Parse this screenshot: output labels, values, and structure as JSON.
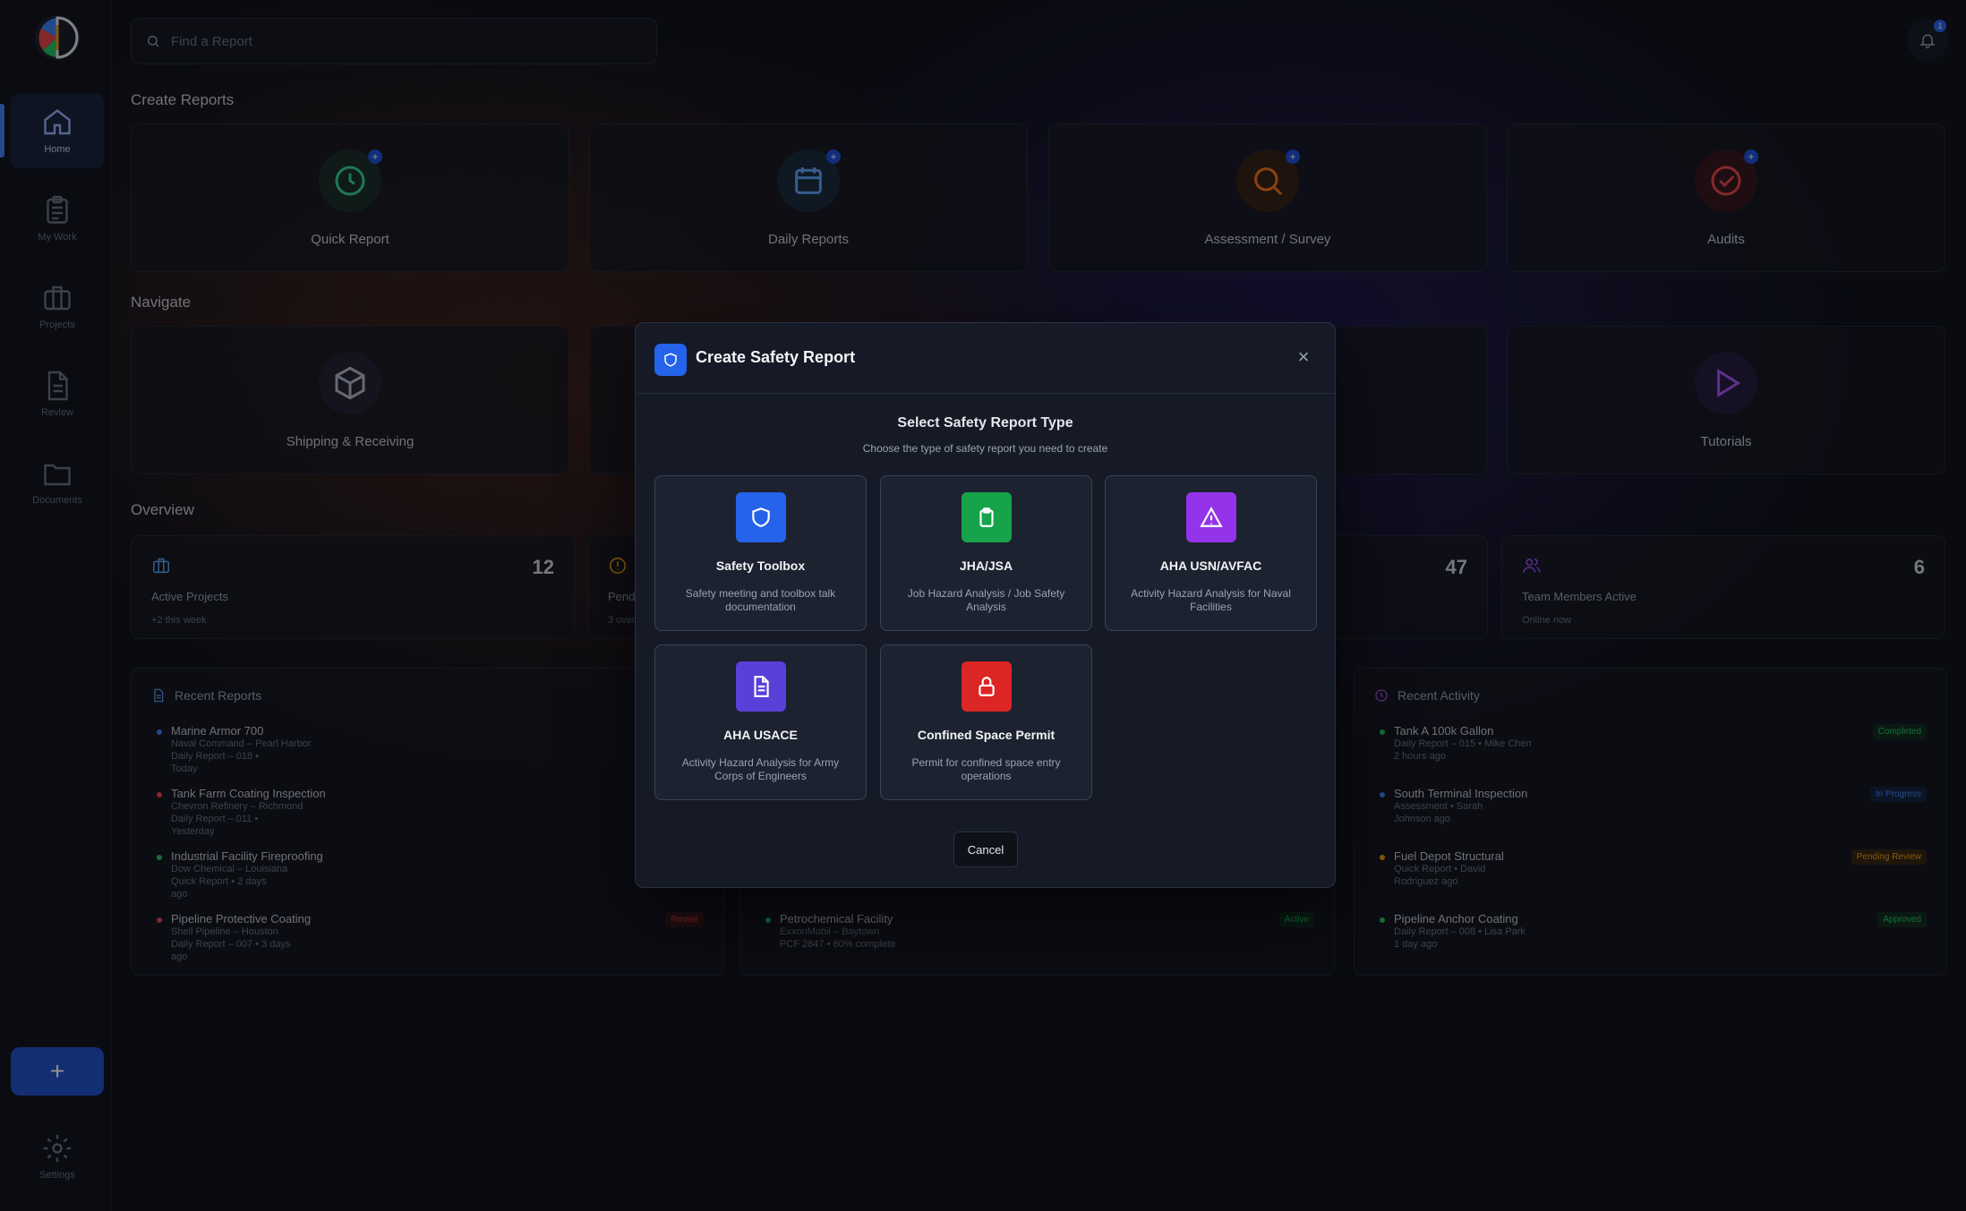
{
  "sidebar": {
    "items": [
      {
        "label": "Home"
      },
      {
        "label": "My Work"
      },
      {
        "label": "Projects"
      },
      {
        "label": "Review"
      },
      {
        "label": "Documents"
      }
    ],
    "add_label": "+",
    "settings_label": "Settings"
  },
  "search": {
    "placeholder": "Find a Report"
  },
  "notifications": {
    "count": "1"
  },
  "create": {
    "title": "Create Reports",
    "cards": [
      {
        "label": "Quick Report",
        "badge": "+"
      },
      {
        "label": "Daily Reports",
        "badge": "+"
      },
      {
        "label": "Assessment / Survey",
        "badge": "+"
      },
      {
        "label": "Audits",
        "badge": "+"
      }
    ]
  },
  "navigate": {
    "title": "Navigate",
    "cards": [
      {
        "label": "Shipping & Receiving"
      },
      {
        "label": "Tutorials"
      }
    ]
  },
  "overview": {
    "title": "Overview",
    "cards": [
      {
        "value": "12",
        "title": "Active Projects",
        "sub": "+2 this week"
      },
      {
        "title": "Pend",
        "sub": "3 over"
      },
      {
        "value": "47"
      },
      {
        "value": "6",
        "title": "Team Members Active",
        "sub": "Online now"
      }
    ]
  },
  "recent_reports": {
    "title": "Recent Reports",
    "rows": [
      {
        "name": "Marine Armor 700",
        "org": "Naval Command – Pearl Harbor",
        "meta": "Daily Report – 018 •",
        "time": "Today",
        "color": "#3b82f6"
      },
      {
        "name": "Tank Farm Coating Inspection",
        "org": "Chevron Refinery – Richmond",
        "meta": "Daily Report – 011 •",
        "time": "Yesterday",
        "color": "#ef4444"
      },
      {
        "name": "Industrial Facility Fireproofing",
        "org": "Dow Chemical – Louisiana",
        "meta": "Quick Report • 2 days",
        "time": "ago",
        "color": "#22c55e"
      },
      {
        "name": "Pipeline Protective Coating",
        "org": "Shell Pipeline – Houston",
        "meta": "Daily Report – 007 • 3 days",
        "time": "ago",
        "color": "#ef4444",
        "tag": "Revise"
      }
    ]
  },
  "middle_list": {
    "row": {
      "name": "Petrochemical Facility",
      "org": "ExxonMobil – Baytown",
      "meta": "PCF 2847 • 60% complete",
      "tag": "Active"
    }
  },
  "recent_activity": {
    "title": "Recent Activity",
    "rows": [
      {
        "name": "Tank A 100k Gallon",
        "meta": "Daily Report – 015 • Mike Chen",
        "time": "2 hours ago",
        "tag": "Completed",
        "color": "#22c55e"
      },
      {
        "name": "South Terminal Inspection",
        "meta": "Assessment • Sarah",
        "time": "Johnson ago",
        "tag": "In Progress",
        "color": "#3b82f6"
      },
      {
        "name": "Fuel Depot Structural",
        "meta": "Quick Report • David",
        "time": "Rodriguez ago",
        "tag": "Pending Review",
        "color": "#f59e0b"
      },
      {
        "name": "Pipeline Anchor Coating",
        "meta": "Daily Report – 008 • Lisa Park",
        "time": "1 day ago",
        "tag": "Approved",
        "color": "#22c55e"
      }
    ]
  },
  "modal": {
    "title": "Create Safety Report",
    "heading": "Select Safety Report Type",
    "subheading": "Choose the type of safety report you need to create",
    "options": [
      {
        "title": "Safety Toolbox",
        "desc": "Safety meeting and toolbox talk documentation",
        "color": "#2563eb"
      },
      {
        "title": "JHA/JSA",
        "desc": "Job Hazard Analysis / Job Safety Analysis",
        "color": "#16a34a"
      },
      {
        "title": "AHA USN/AVFAC",
        "desc": "Activity Hazard Analysis for Naval Facilities",
        "color": "#9333ea"
      },
      {
        "title": "AHA USACE",
        "desc": "Activity Hazard Analysis for Army Corps of Engineers",
        "color": "#5b3fd9"
      },
      {
        "title": "Confined Space Permit",
        "desc": "Permit for confined space entry operations",
        "color": "#dc2626"
      }
    ],
    "cancel_label": "Cancel",
    "close_glyph": "×"
  }
}
